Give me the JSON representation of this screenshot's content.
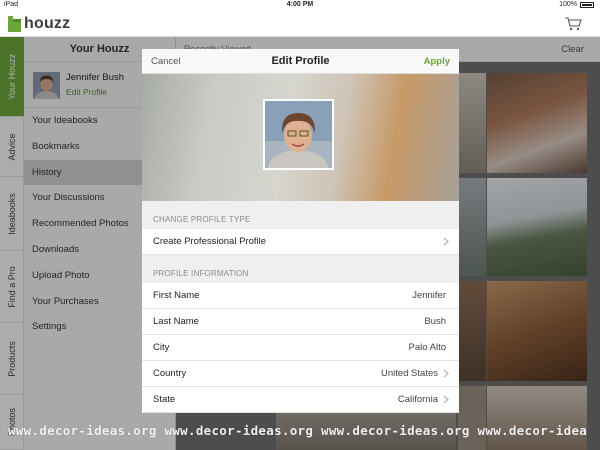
{
  "status_bar": {
    "carrier": "iPad",
    "time": "4:00 PM",
    "battery": "100%"
  },
  "app": {
    "logo_text": "houzz"
  },
  "vertical_tabs": [
    "Your Houzz",
    "Advice",
    "Ideabooks",
    "Find a Pro",
    "Products",
    "Photos"
  ],
  "menu": {
    "title": "Your Houzz",
    "user_name": "Jennifer Bush",
    "edit_profile": "Edit Profile",
    "items": [
      "Your Ideabooks",
      "Bookmarks",
      "History",
      "Your Discussions",
      "Recommended Photos",
      "Downloads",
      "Upload Photo",
      "Your Purchases",
      "Settings"
    ],
    "selected": "History"
  },
  "content": {
    "recently_viewed": "Recently Viewed",
    "clear": "Clear"
  },
  "modal": {
    "title": "Edit Profile",
    "cancel": "Cancel",
    "apply": "Apply",
    "section_profile_type": "CHANGE PROFILE TYPE",
    "create_professional": "Create Professional Profile",
    "section_profile_info": "PROFILE INFORMATION",
    "fields": [
      {
        "label": "First Name",
        "value": "Jennifer"
      },
      {
        "label": "Last Name",
        "value": "Bush"
      },
      {
        "label": "City",
        "value": "Palo Alto"
      },
      {
        "label": "Country",
        "value": "United States"
      },
      {
        "label": "State",
        "value": "California"
      }
    ]
  },
  "watermark": "www.decor-ideas.org www.decor-ideas.org www.decor-ideas.org www.decor-idea",
  "colors": {
    "brand_green": "#6ca53a",
    "selected_row": "#cfcfcf"
  },
  "icons": [
    "wifi-icon",
    "battery-icon",
    "houzz-logo-icon",
    "cart-icon",
    "chevron-right-icon"
  ]
}
